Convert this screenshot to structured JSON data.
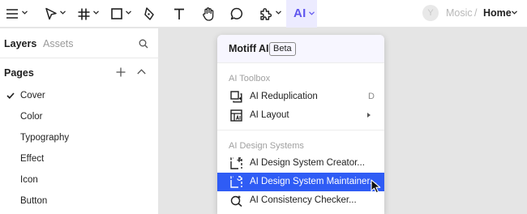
{
  "toolbar": {
    "tools": [
      {
        "name": "main-menu",
        "icon": "hamburger-icon",
        "has_caret": true
      },
      {
        "name": "move-tool",
        "icon": "pointer-icon",
        "has_caret": true
      },
      {
        "name": "frame-tool",
        "icon": "hash-icon",
        "has_caret": true
      },
      {
        "name": "shape-tool",
        "icon": "square-icon",
        "has_caret": true
      },
      {
        "name": "pen-tool",
        "icon": "pen-icon",
        "has_caret": false
      },
      {
        "name": "text-tool",
        "icon": "text-icon",
        "has_caret": false
      },
      {
        "name": "hand-tool",
        "icon": "hand-icon",
        "has_caret": false
      },
      {
        "name": "comment-tool",
        "icon": "comment-icon",
        "has_caret": false
      },
      {
        "name": "plugin-tool",
        "icon": "puzzle-icon",
        "has_caret": true
      }
    ],
    "ai_button_label": "AI",
    "avatar_initial": "Y",
    "project_name": "Mosic",
    "separator": "/",
    "page_name": "Home",
    "accent_color": "#5f55ee"
  },
  "sidebar": {
    "tabs": [
      "Layers",
      "Assets"
    ],
    "active_tab": "Layers",
    "pages_title": "Pages",
    "pages": [
      "Cover",
      "Color",
      "Typography",
      "Effect",
      "Icon",
      "Button"
    ],
    "selected_page": "Cover"
  },
  "menu": {
    "title": "Motiff AI",
    "badge": "Beta",
    "section_toolbox": "AI Toolbox",
    "toolbox_items": [
      {
        "label": "AI Reduplication",
        "icon": "reduplication-icon",
        "shortcut": "D"
      },
      {
        "label": "AI Layout",
        "icon": "layout-icon",
        "submenu": true
      }
    ],
    "section_design_systems": "AI Design Systems",
    "design_system_items": [
      {
        "label": "AI Design System Creator...",
        "icon": "creator-icon"
      },
      {
        "label": "AI Design System Maintainer...",
        "icon": "maintainer-icon",
        "highlighted": true
      },
      {
        "label": "AI Consistency Checker...",
        "icon": "checker-icon"
      }
    ],
    "highlight_color": "#2f5cf5"
  }
}
